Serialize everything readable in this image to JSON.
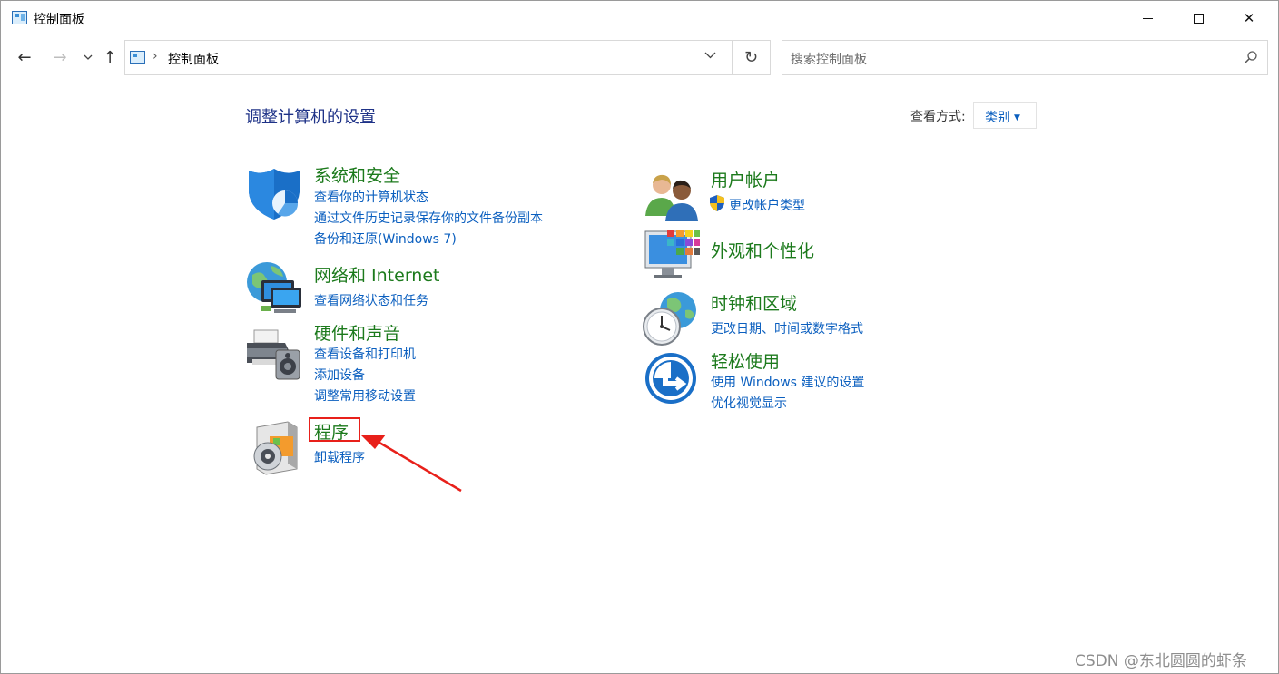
{
  "window": {
    "title": "控制面板",
    "minimize_glyph": "",
    "close_glyph": "✕"
  },
  "nav": {
    "back_glyph": "←",
    "forward_glyph": "→",
    "recent_glyph": "⌄",
    "up_glyph": "↑",
    "address_sep": "›",
    "address_text": "控制面板",
    "address_dropdown": "∨",
    "refresh_glyph": "↻",
    "search_placeholder": "搜索控制面板"
  },
  "content": {
    "page_title": "调整计算机的设置",
    "view_label": "查看方式:",
    "view_value": "类别",
    "view_caret": "▼"
  },
  "categories": [
    {
      "icon": "shield-icon",
      "title": "系统和安全",
      "links": [
        "查看你的计算机状态",
        "通过文件历史记录保存你的文件备份副本",
        "备份和还原(Windows 7)"
      ]
    },
    {
      "icon": "network-globe-icon",
      "title": "网络和 Internet",
      "links": [
        "查看网络状态和任务"
      ]
    },
    {
      "icon": "printer-speaker-icon",
      "title": "硬件和声音",
      "links": [
        "查看设备和打印机",
        "添加设备",
        "调整常用移动设置"
      ]
    },
    {
      "icon": "programs-disc-icon",
      "title": "程序",
      "links": [
        "卸载程序"
      ]
    },
    {
      "icon": "users-icon",
      "title": "用户帐户",
      "links": [
        "更改帐户类型"
      ]
    },
    {
      "icon": "monitor-palette-icon",
      "title": "外观和个性化",
      "links": []
    },
    {
      "icon": "clock-globe-icon",
      "title": "时钟和区域",
      "links": [
        "更改日期、时间或数字格式"
      ]
    },
    {
      "icon": "ease-of-access-icon",
      "title": "轻松使用",
      "links": [
        "使用 Windows 建议的设置",
        "优化视觉显示"
      ]
    }
  ],
  "colors": {
    "category_title": "#1c7a1c",
    "link": "#0b5fbf",
    "page_title": "#1e3287",
    "annotation_red": "#e8201a"
  },
  "watermark": "CSDN @东北圆圆的虾条"
}
